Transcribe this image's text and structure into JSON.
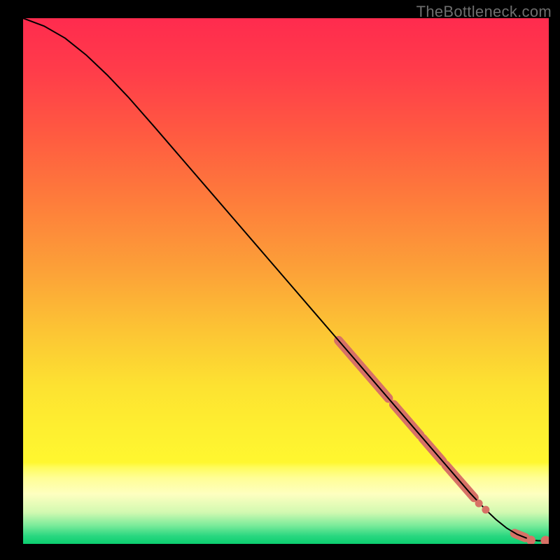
{
  "watermark": "TheBottleneck.com",
  "palette": {
    "black": "#000000",
    "curve": "#000000",
    "dot": "#d77166"
  },
  "gradient_stops": [
    {
      "offset": 0.0,
      "color": "#ff2b4e"
    },
    {
      "offset": 0.1,
      "color": "#ff3c4a"
    },
    {
      "offset": 0.22,
      "color": "#ff5a41"
    },
    {
      "offset": 0.35,
      "color": "#fe7d3b"
    },
    {
      "offset": 0.48,
      "color": "#fca138"
    },
    {
      "offset": 0.6,
      "color": "#fcc634"
    },
    {
      "offset": 0.7,
      "color": "#fde231"
    },
    {
      "offset": 0.78,
      "color": "#feef30"
    },
    {
      "offset": 0.845,
      "color": "#fff72f"
    },
    {
      "offset": 0.855,
      "color": "#fffc5e"
    },
    {
      "offset": 0.875,
      "color": "#fffe96"
    },
    {
      "offset": 0.905,
      "color": "#feffc0"
    },
    {
      "offset": 0.94,
      "color": "#d2f9b1"
    },
    {
      "offset": 0.965,
      "color": "#7aeb9a"
    },
    {
      "offset": 0.985,
      "color": "#29d780"
    },
    {
      "offset": 1.0,
      "color": "#0bce6f"
    }
  ],
  "chart_data": {
    "type": "line",
    "title": "",
    "xlabel": "",
    "ylabel": "",
    "xlim": [
      0,
      100
    ],
    "ylim": [
      0,
      100
    ],
    "curve": {
      "x": [
        0,
        4,
        8,
        12,
        16,
        20,
        25,
        30,
        35,
        40,
        45,
        50,
        55,
        60,
        65,
        70,
        75,
        80,
        85,
        88,
        90,
        92,
        94,
        96,
        97,
        98,
        99,
        100
      ],
      "y": [
        100,
        98.5,
        96.2,
        93.0,
        89.2,
        85.0,
        79.3,
        73.5,
        67.7,
        61.9,
        56.1,
        50.3,
        44.5,
        38.7,
        32.9,
        27.1,
        21.3,
        15.5,
        9.7,
        6.5,
        4.6,
        3.0,
        1.8,
        1.0,
        0.7,
        0.6,
        0.6,
        0.6
      ]
    },
    "highlight_segments": [
      {
        "x0": 60.0,
        "y0": 38.7,
        "x1": 69.5,
        "y1": 27.7
      },
      {
        "x0": 70.5,
        "y0": 26.5,
        "x1": 75.5,
        "y1": 20.7
      },
      {
        "x0": 76.0,
        "y0": 20.1,
        "x1": 79.8,
        "y1": 15.7
      },
      {
        "x0": 80.4,
        "y0": 15.0,
        "x1": 85.8,
        "y1": 8.8
      },
      {
        "x0": 93.5,
        "y0": 2.0,
        "x1": 95.5,
        "y1": 1.2
      }
    ],
    "dots": [
      {
        "x": 86.7,
        "y": 7.7,
        "r": 5.5
      },
      {
        "x": 88.0,
        "y": 6.5,
        "r": 5.5
      },
      {
        "x": 96.6,
        "y": 0.7,
        "r": 6.5
      },
      {
        "x": 99.4,
        "y": 0.6,
        "r": 7.0
      },
      {
        "x": 100.2,
        "y": 0.6,
        "r": 5.5
      }
    ]
  }
}
